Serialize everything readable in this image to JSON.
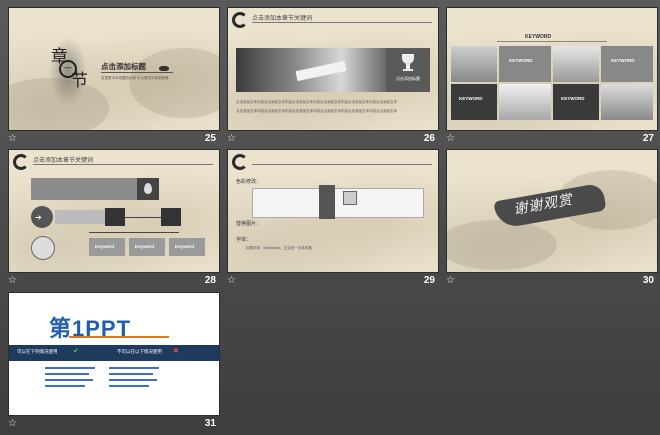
{
  "slides": [
    {
      "number": "25",
      "title": "点击添加标题",
      "chapter_chars": [
        "章",
        "节",
        "一"
      ],
      "subtitle": "这里是字体设置的示例 可以修改字体颜色等"
    },
    {
      "number": "26",
      "title": "点击添加本章节关键词",
      "award_label": "点击添加标题",
      "body_text": "点击添加文本内容点击添加文本内容点击添加文本内容点击添加文本内容点击添加文本内容点击添加文本"
    },
    {
      "number": "27",
      "keywords": [
        "KEYWORD",
        "KEYWORD",
        "KEYWORD",
        "KEYWORD",
        "KEYWORD"
      ]
    },
    {
      "number": "28",
      "title": "点击添加本章节关键词",
      "box_labels": [
        "Keyword",
        "Keyword",
        "Keyword"
      ]
    },
    {
      "number": "29",
      "bullets": [
        "色彩修改：",
        "替换图片：",
        "字体："
      ],
      "font_line": "标题字体：Montserrat，正文统一字体风格"
    },
    {
      "number": "30",
      "calligraphy": "谢谢观赏"
    },
    {
      "number": "31",
      "logo_text": "第1PPT",
      "panel_left": "可以在下列情况使用",
      "panel_right": "不可以在以下情况使用"
    }
  ],
  "icons": {
    "star": "☆"
  }
}
